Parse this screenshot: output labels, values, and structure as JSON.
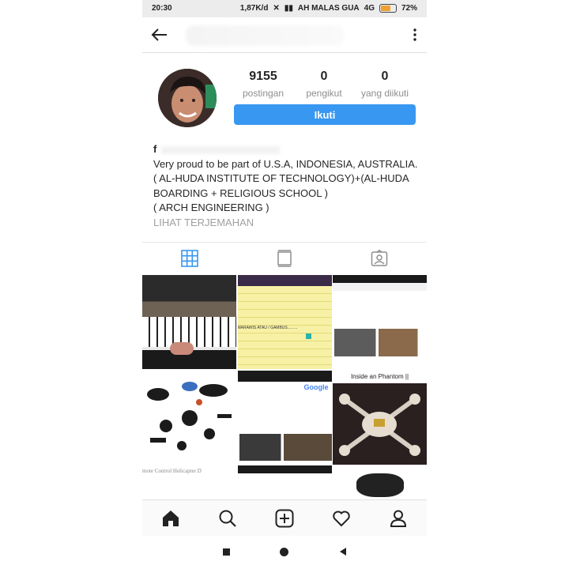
{
  "status_bar": {
    "time": "20:30",
    "speed": "1,87K/d",
    "carrier": "AH MALAS GUA",
    "network": "4G",
    "battery": "72%",
    "battery_level": 0.72
  },
  "header": {
    "back_icon": "arrow-left-icon",
    "more_icon": "vertical-dots-icon"
  },
  "profile": {
    "stats": [
      {
        "count": "9155",
        "label": "postingan"
      },
      {
        "count": "0",
        "label": "pengikut"
      },
      {
        "count": "0",
        "label": "yang diikuti"
      }
    ],
    "follow_label": "Ikuti",
    "name_initial": "f",
    "bio_lines": [
      "Very proud to be part of U.S.A, INDONESIA, AUSTRALIA.",
      "( AL-HUDA INSTITUTE OF TECHNOLOGY)+(AL-HUDA",
      "BOARDING  + RELIGIOUS SCHOOL )",
      "( ARCH ENGINEERING )"
    ],
    "translate_label": "LIHAT TERJEMAHAN",
    "accent_color": "#3897f0"
  },
  "tabs": [
    {
      "icon": "grid-icon",
      "active": true
    },
    {
      "icon": "feed-icon",
      "active": false
    },
    {
      "icon": "tagged-icon",
      "active": false
    }
  ],
  "grid": {
    "cell2_text": "MARAWIS ATAU / GAMBUS.........",
    "cell5_logo": "Google",
    "cell6_title": "Inside an Phantom ||",
    "cell7_text": "mote Control Helicapter D"
  },
  "bottom_nav": [
    {
      "icon": "home-icon"
    },
    {
      "icon": "search-icon"
    },
    {
      "icon": "add-post-icon"
    },
    {
      "icon": "heart-icon"
    },
    {
      "icon": "profile-icon"
    }
  ],
  "system_nav": [
    {
      "icon": "recents-icon"
    },
    {
      "icon": "home-circle-icon"
    },
    {
      "icon": "back-triangle-icon"
    }
  ]
}
